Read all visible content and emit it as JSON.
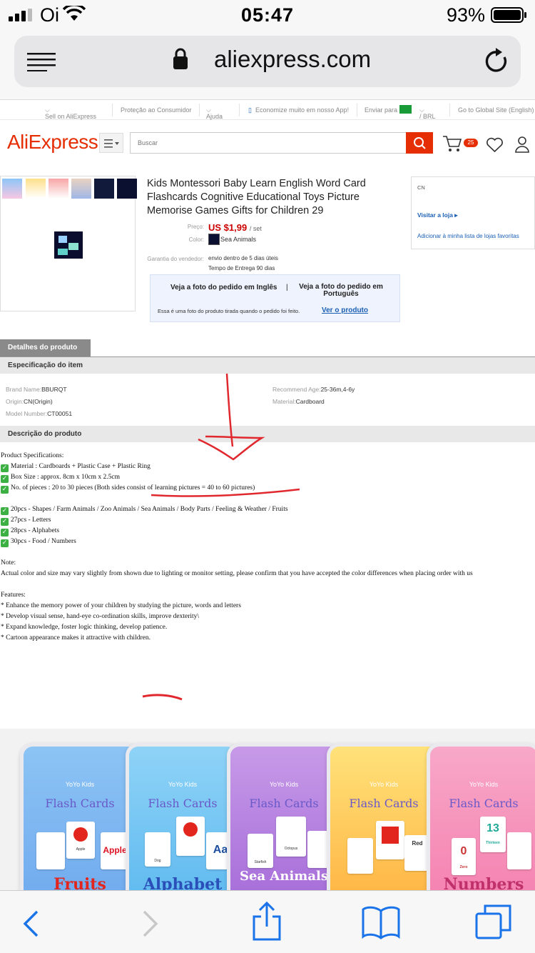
{
  "status_bar": {
    "carrier": "Oi",
    "time": "05:47",
    "battery": "93%"
  },
  "browser": {
    "url": "aliexpress.com"
  },
  "util_bar": {
    "sell": "Sell on AliExpress",
    "protection": "Proteção ao Consumidor",
    "help": "Ajuda",
    "app": "Economize muito em nosso App!",
    "ship_to": "Enviar para",
    "currency": "/ BRL",
    "global": "Go to Global Site (English)"
  },
  "header": {
    "logo": "AliExpress",
    "search_placeholder": "Buscar",
    "cart_count": "25"
  },
  "product": {
    "title": "Kids Montessori Baby Learn English Word Card Flashcards Cognitive Educational Toys Picture Memorise Games Gifts for Children 29",
    "price_label": "Preço:",
    "price": "US $1,99",
    "price_unit": "/ set",
    "color_label": "Color:",
    "color_value": "Sea Animals",
    "guarantee_label": "Garantia do vendedor:",
    "guarantee_1": "envio dentro de 5 dias úteis",
    "guarantee_2": "Tempo de Entrega 90 dias"
  },
  "photo_box": {
    "link_en": "Veja a foto do pedido em Inglês",
    "link_pt": "Veja a foto do pedido em Português",
    "note": "Essa é uma foto do produto tirada quando o pedido foi feito.",
    "view_product": "Ver o produto"
  },
  "store": {
    "country": "CN",
    "visit": "Visitar a loja",
    "wishlist": "Adicionar à minha lista de lojas favoritas"
  },
  "tabs": {
    "details": "Detalhes do produto"
  },
  "spec": {
    "section_title": "Especificação do item",
    "items": [
      {
        "k": "Brand Name:",
        "v": "BBURQT"
      },
      {
        "k": "Recommend Age:",
        "v": "25-36m,4-6y"
      },
      {
        "k": "Origin:",
        "v": "CN(Origin)"
      },
      {
        "k": "Material:",
        "v": "Cardboard"
      },
      {
        "k": "Model Number:",
        "v": "CT00051"
      }
    ]
  },
  "description": {
    "section_title": "Descrição do produto",
    "heading": "Product Specifications:",
    "specs": [
      "Material : Cardboards + Plastic Case + Plastic Ring",
      "Box Size : approx. 8cm x 10cm x 2.5cm",
      "No. of pieces : 20 to 30 pieces (Both sides consist of learning pictures = 40 to 60 pictures)"
    ],
    "counts": [
      "20pcs - Shapes / Farm Animals / Zoo Animals / Sea Animals / Body Parts / Feeling & Weather / Fruits",
      "27pcs - Letters",
      "28pcs - Alphabets",
      "30pcs - Food / Numbers"
    ],
    "note_title": "Note:",
    "note": "Actual color and size may vary slightly from shown due to lighting or monitor setting, please confirm that you have accepted the color differences when placing order with us",
    "features_title": "Features:",
    "features": [
      "* Enhance the memory power of your children by studying the picture, words and letters",
      "* Develop visual sense, hand-eye co-ordination skills, improve dexterity\\",
      "* Expand knowledge, foster logic thinking, develop patience.",
      "* Cartoon appearance makes it attractive with children."
    ]
  },
  "boxes": {
    "brand": "YoYo Kids",
    "title": "Flash Cards",
    "names": [
      "Fruits",
      "Alphabet",
      "Sea Animals",
      "",
      "Numbers"
    ],
    "cards": [
      "Apple",
      "Apple",
      "Aa",
      "Dog",
      "Octopus",
      "Starfish",
      "Red",
      "13",
      "Thirteen",
      "0",
      "Zero"
    ]
  },
  "colors": {
    "brand": "#e62e04",
    "link": "#1a5fb4",
    "annotation": "#e0282e"
  }
}
